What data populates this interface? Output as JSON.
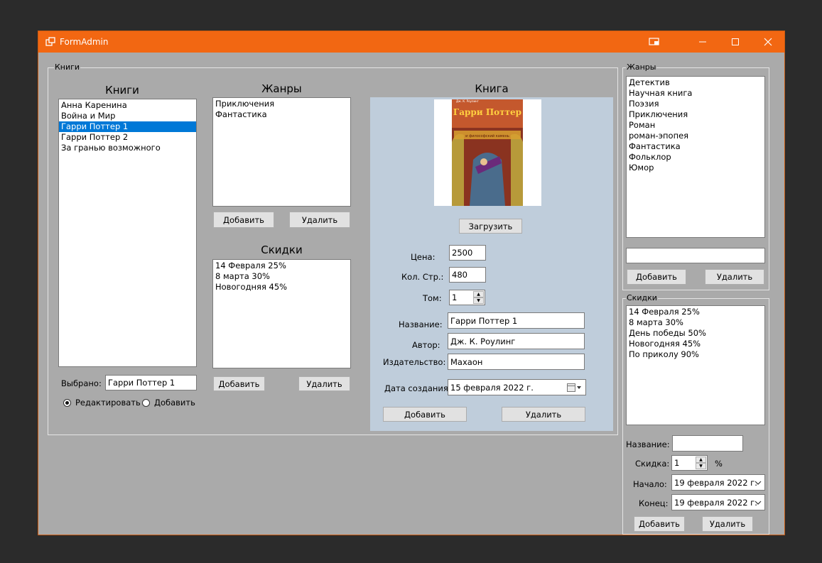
{
  "window": {
    "title": "FormAdmin"
  },
  "books_group": {
    "title": "Книги",
    "books": {
      "heading": "Книги",
      "items": [
        "Анна Каренина",
        "Война и Мир",
        "Гарри Поттер 1",
        "Гарри Поттер 2",
        "За гранью возможного"
      ],
      "selected_index": 2,
      "selected_label": "Выбрано:",
      "selected_value": "Гарри Поттер 1",
      "mode_edit": "Редактировать",
      "mode_add": "Добавить"
    },
    "genres": {
      "heading": "Жанры",
      "items": [
        "Приключения",
        "Фантастика"
      ],
      "add": "Добавить",
      "delete": "Удалить"
    },
    "discounts": {
      "heading": "Скидки",
      "items": [
        "14 Февраля 25%",
        "8 марта 30%",
        "Новогодняя 45%"
      ],
      "add": "Добавить",
      "delete": "Удалить"
    },
    "book": {
      "heading": "Книга",
      "cover_top_text": "Дж. К. Роулинг",
      "cover_title": "Гарри Поттер",
      "cover_subtitle": "и философский камень",
      "upload": "Загрузить",
      "price_label": "Цена:",
      "price": "2500",
      "pages_label": "Кол. Стр.:",
      "pages": "480",
      "volume_label": "Том:",
      "volume": "1",
      "name_label": "Название:",
      "name": "Гарри Поттер 1",
      "author_label": "Автор:",
      "author": "Дж. К. Роулинг",
      "publisher_label": "Издательство:",
      "publisher": "Махаон",
      "created_label": "Дата создания:",
      "created": "15 февраля  2022 г.",
      "add": "Добавить",
      "delete": "Удалить"
    }
  },
  "genres_group": {
    "title": "Жанры",
    "items": [
      "Детектив",
      "Научная книга",
      "Поэзия",
      "Приключения",
      "Роман",
      "роман-эпопея",
      "Фантастика",
      "Фольклор",
      "Юмор"
    ],
    "new_value": "",
    "add": "Добавить",
    "delete": "Удалить"
  },
  "discounts_group": {
    "title": "Скидки",
    "items": [
      "14 Февраля 25%",
      "8 марта 30%",
      "День победы 50%",
      "Новогодняя 45%",
      "По приколу  90%"
    ],
    "name_label": "Название:",
    "name": "",
    "discount_label": "Скидка:",
    "discount": "1",
    "percent": "%",
    "start_label": "Начало:",
    "start": "19 февраля  2022 г.",
    "end_label": "Конец:",
    "end": "19 февраля  2022 г.",
    "add": "Добавить",
    "delete": "Удалить"
  },
  "colors": {
    "titlebar": "#f26712",
    "form_bg": "#aaaaaa",
    "panel_bg": "#bfcddb",
    "selection": "#0078d7"
  }
}
